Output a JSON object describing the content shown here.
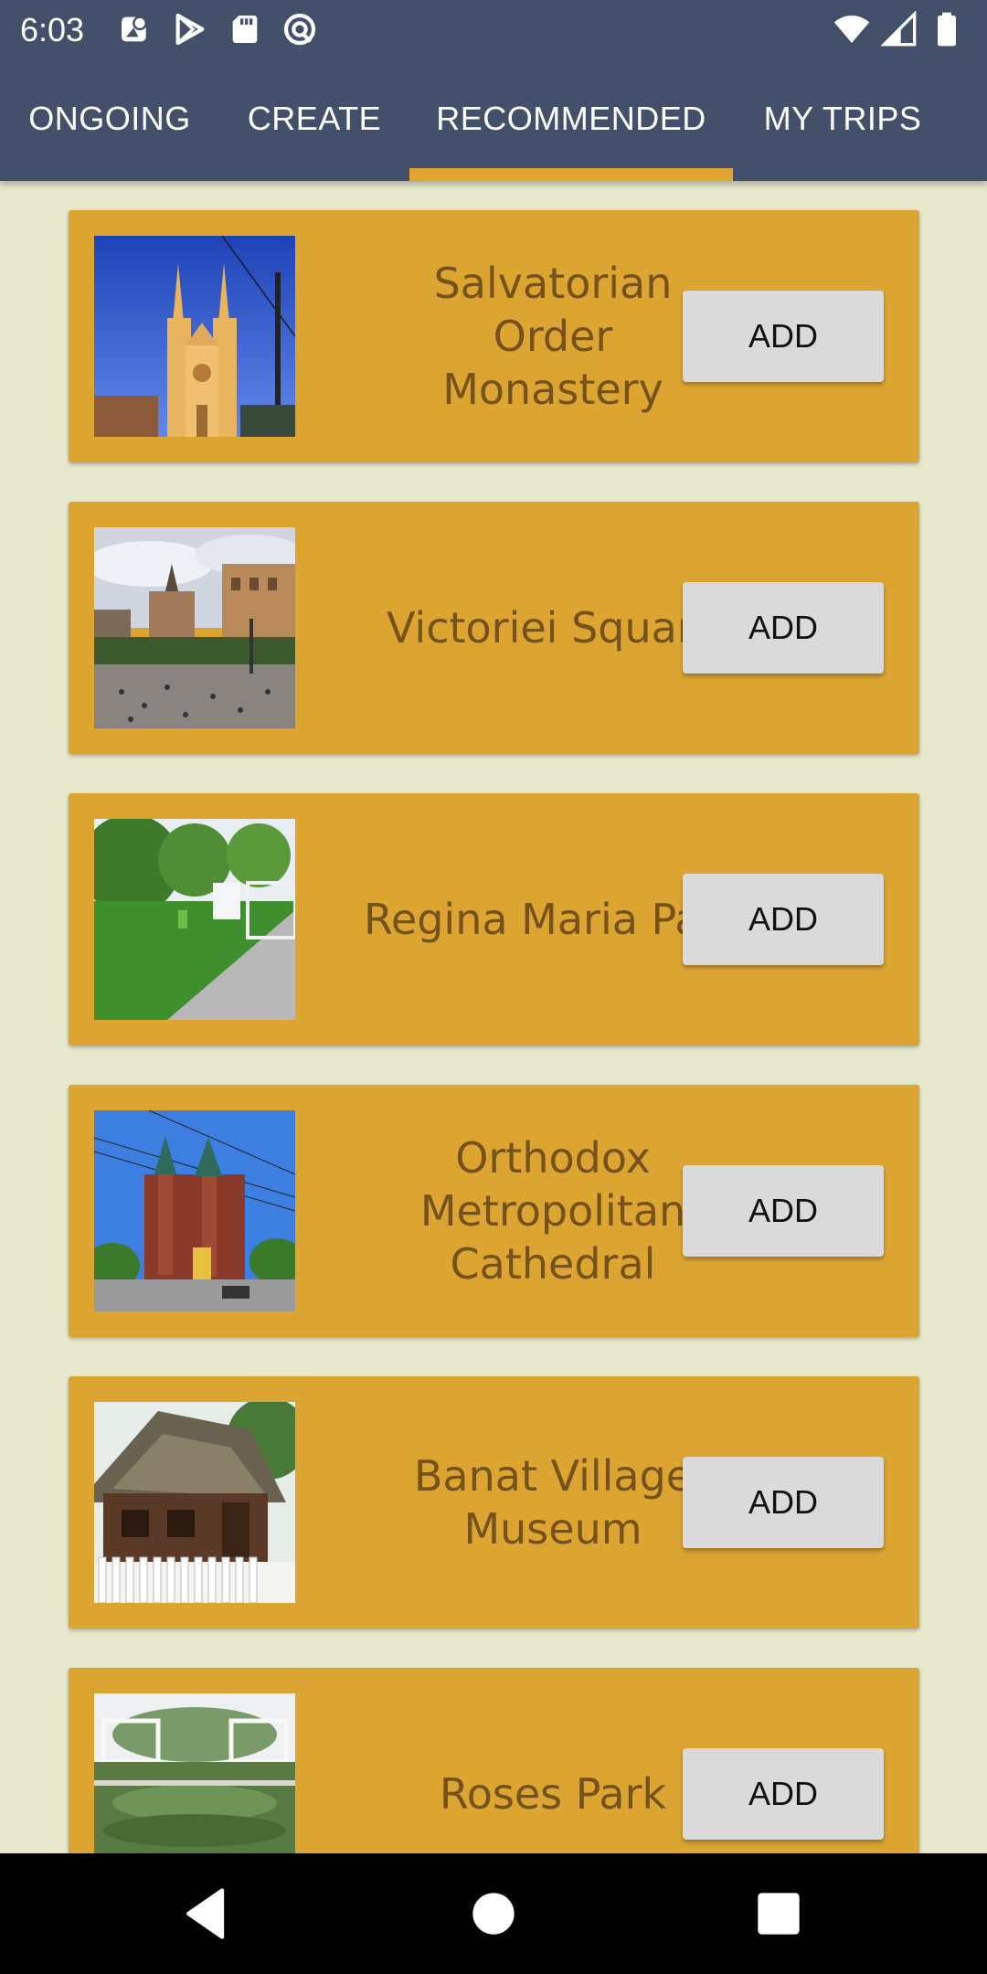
{
  "status_bar": {
    "time": "6:03",
    "left_icons": [
      "maps-notification-icon",
      "play-store-icon",
      "sd-card-icon",
      "vpn-icon"
    ],
    "right_icons": [
      "wifi-icon",
      "cell-signal-icon",
      "battery-icon"
    ]
  },
  "tabs": [
    {
      "label": "ONGOING",
      "selected": false
    },
    {
      "label": "CREATE",
      "selected": false
    },
    {
      "label": "RECOMMENDED",
      "selected": true
    },
    {
      "label": "MY TRIPS",
      "selected": false
    }
  ],
  "colors": {
    "app_bar": "#445069",
    "tab_indicator": "#e2a532",
    "background": "#e7e8cc",
    "card": "#dca532",
    "card_text": "#75511b",
    "button": "#dadada"
  },
  "places": [
    {
      "name": "Salvatorian Order Monastery",
      "button": "ADD"
    },
    {
      "name": "Victoriei Square",
      "button": "ADD"
    },
    {
      "name": "Regina Maria Park",
      "button": "ADD"
    },
    {
      "name": "Orthodox Metropolitan Cathedral",
      "button": "ADD"
    },
    {
      "name": "Banat Village Museum",
      "button": "ADD"
    },
    {
      "name": "Roses Park",
      "button": "ADD"
    }
  ],
  "nav_bar": {
    "buttons": [
      "back-icon",
      "home-icon",
      "recents-icon"
    ]
  }
}
